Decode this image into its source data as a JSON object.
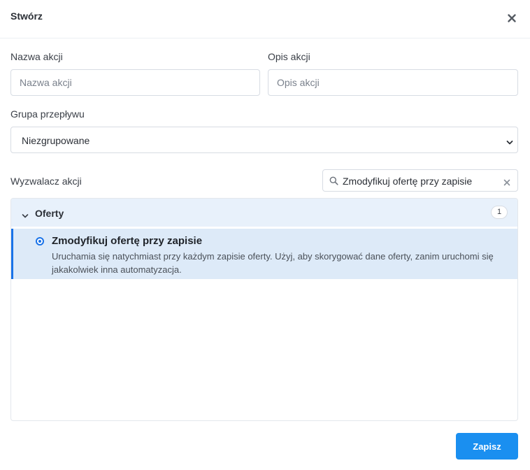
{
  "dialog": {
    "title": "Stwórz"
  },
  "form": {
    "action_name": {
      "label": "Nazwa akcji",
      "placeholder": "Nazwa akcji",
      "value": ""
    },
    "action_description": {
      "label": "Opis akcji",
      "placeholder": "Opis akcji",
      "value": ""
    },
    "flow_group": {
      "label": "Grupa przepływu",
      "selected": "Niezgrupowane"
    },
    "trigger": {
      "label": "Wyzwalacz akcji",
      "search_value": "Zmodyfikuj ofertę przy zapisie",
      "groups": [
        {
          "name": "Oferty",
          "count": "1",
          "expanded": true,
          "options": [
            {
              "title": "Zmodyfikuj ofertę przy zapisie",
              "description": "Uruchamia się natychmiast przy każdym zapisie oferty. Użyj, aby skorygować dane oferty, zanim uruchomi się jakakolwiek inna automatyzacja.",
              "selected": true
            }
          ]
        }
      ]
    }
  },
  "footer": {
    "save_label": "Zapisz"
  },
  "colors": {
    "accent": "#1a8ff0",
    "selected_row_bg": "#ddeaf8",
    "group_header_bg": "#e8f1fb"
  },
  "icons": {
    "close": "close-icon",
    "select_chevron": "chevron-down-icon",
    "search": "search-icon",
    "clear": "clear-icon",
    "group_toggle": "chevron-down-icon"
  }
}
